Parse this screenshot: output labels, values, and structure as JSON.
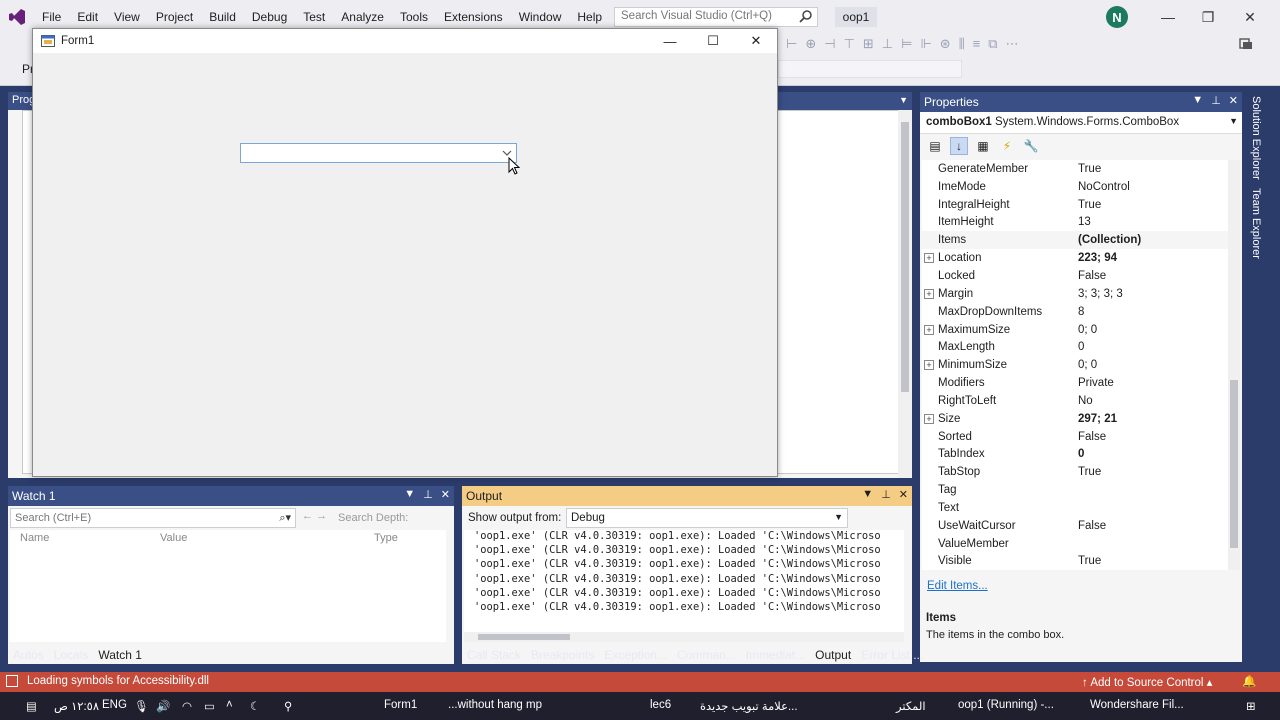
{
  "menu": [
    "File",
    "Edit",
    "View",
    "Project",
    "Build",
    "Debug",
    "Test",
    "Analyze",
    "Tools",
    "Extensions",
    "Window",
    "Help"
  ],
  "search": {
    "placeholder": "Search Visual Studio (Ctrl+Q)"
  },
  "project_name": "oop1",
  "user_initial": "N",
  "window_controls": {
    "minimize": "—",
    "restore": "❐",
    "close": "✕"
  },
  "doc_tab": "Prog",
  "toolbar2_label": "Pr",
  "form": {
    "title": "Form1",
    "minimize": "—",
    "maximize": "☐",
    "close": "✕"
  },
  "properties": {
    "header": "Properties",
    "object_name": "comboBox1",
    "object_type": "System.Windows.Forms.ComboBox",
    "rows": [
      {
        "name": "GenerateMember",
        "value": "True",
        "expand": false,
        "bold": false
      },
      {
        "name": "ImeMode",
        "value": "NoControl",
        "expand": false,
        "bold": false
      },
      {
        "name": "IntegralHeight",
        "value": "True",
        "expand": false,
        "bold": false
      },
      {
        "name": "ItemHeight",
        "value": "13",
        "expand": false,
        "bold": false
      },
      {
        "name": "Items",
        "value": "(Collection)",
        "expand": false,
        "bold": true
      },
      {
        "name": "Location",
        "value": "223; 94",
        "expand": true,
        "bold": true
      },
      {
        "name": "Locked",
        "value": "False",
        "expand": false,
        "bold": false
      },
      {
        "name": "Margin",
        "value": "3; 3; 3; 3",
        "expand": true,
        "bold": false
      },
      {
        "name": "MaxDropDownItems",
        "value": "8",
        "expand": false,
        "bold": false
      },
      {
        "name": "MaximumSize",
        "value": "0; 0",
        "expand": true,
        "bold": false
      },
      {
        "name": "MaxLength",
        "value": "0",
        "expand": false,
        "bold": false
      },
      {
        "name": "MinimumSize",
        "value": "0; 0",
        "expand": true,
        "bold": false
      },
      {
        "name": "Modifiers",
        "value": "Private",
        "expand": false,
        "bold": false
      },
      {
        "name": "RightToLeft",
        "value": "No",
        "expand": false,
        "bold": false
      },
      {
        "name": "Size",
        "value": "297; 21",
        "expand": true,
        "bold": true
      },
      {
        "name": "Sorted",
        "value": "False",
        "expand": false,
        "bold": false
      },
      {
        "name": "TabIndex",
        "value": "0",
        "expand": false,
        "bold": true
      },
      {
        "name": "TabStop",
        "value": "True",
        "expand": false,
        "bold": false
      },
      {
        "name": "Tag",
        "value": "",
        "expand": false,
        "bold": false
      },
      {
        "name": "Text",
        "value": "",
        "expand": false,
        "bold": false
      },
      {
        "name": "UseWaitCursor",
        "value": "False",
        "expand": false,
        "bold": false
      },
      {
        "name": "ValueMember",
        "value": "",
        "expand": false,
        "bold": false
      },
      {
        "name": "Visible",
        "value": "True",
        "expand": false,
        "bold": false
      }
    ],
    "edit_items": "Edit Items...",
    "desc_title": "Items",
    "desc_text": "The items in the combo box."
  },
  "side_tabs": [
    "Solution Explorer",
    "Team Explorer"
  ],
  "watch": {
    "header": "Watch 1",
    "search_placeholder": "Search (Ctrl+E)",
    "search_depth": "Search Depth:",
    "columns": [
      "Name",
      "Value",
      "Type"
    ],
    "tabs": [
      "Autos",
      "Locals",
      "Watch 1"
    ],
    "active_tab": "Watch 1"
  },
  "output": {
    "header": "Output",
    "show_from_label": "Show output from:",
    "show_from_value": "Debug",
    "lines": [
      "'oop1.exe' (CLR v4.0.30319: oop1.exe): Loaded 'C:\\Windows\\Microso",
      "'oop1.exe' (CLR v4.0.30319: oop1.exe): Loaded 'C:\\Windows\\Microso",
      "'oop1.exe' (CLR v4.0.30319: oop1.exe): Loaded 'C:\\Windows\\Microso",
      "'oop1.exe' (CLR v4.0.30319: oop1.exe): Loaded 'C:\\Windows\\Microso",
      "'oop1.exe' (CLR v4.0.30319: oop1.exe): Loaded 'C:\\Windows\\Microso",
      "'oop1.exe' (CLR v4.0.30319: oop1.exe): Loaded 'C:\\Windows\\Microso"
    ],
    "tabs": [
      "Call Stack",
      "Breakpoints",
      "Exception...",
      "Comman...",
      "Immediat...",
      "Output",
      "Error List ..."
    ],
    "active_tab": "Output"
  },
  "status": {
    "text": "Loading symbols for Accessibility.dll",
    "source_control": "Add to Source Control",
    "bell": "🔔"
  },
  "taskbar": {
    "time": "١٢:٥٨ ص",
    "lang": "ENG",
    "items": [
      "Form1",
      "...without hang mp",
      "lec6",
      "علامة تبويب جديدة...",
      "المكتر",
      "oop1 (Running) -...",
      "Wondershare Fil..."
    ]
  },
  "colors": {
    "accent": "#3a4f86",
    "status": "#c64a3a",
    "output_header": "#f5cc84"
  }
}
